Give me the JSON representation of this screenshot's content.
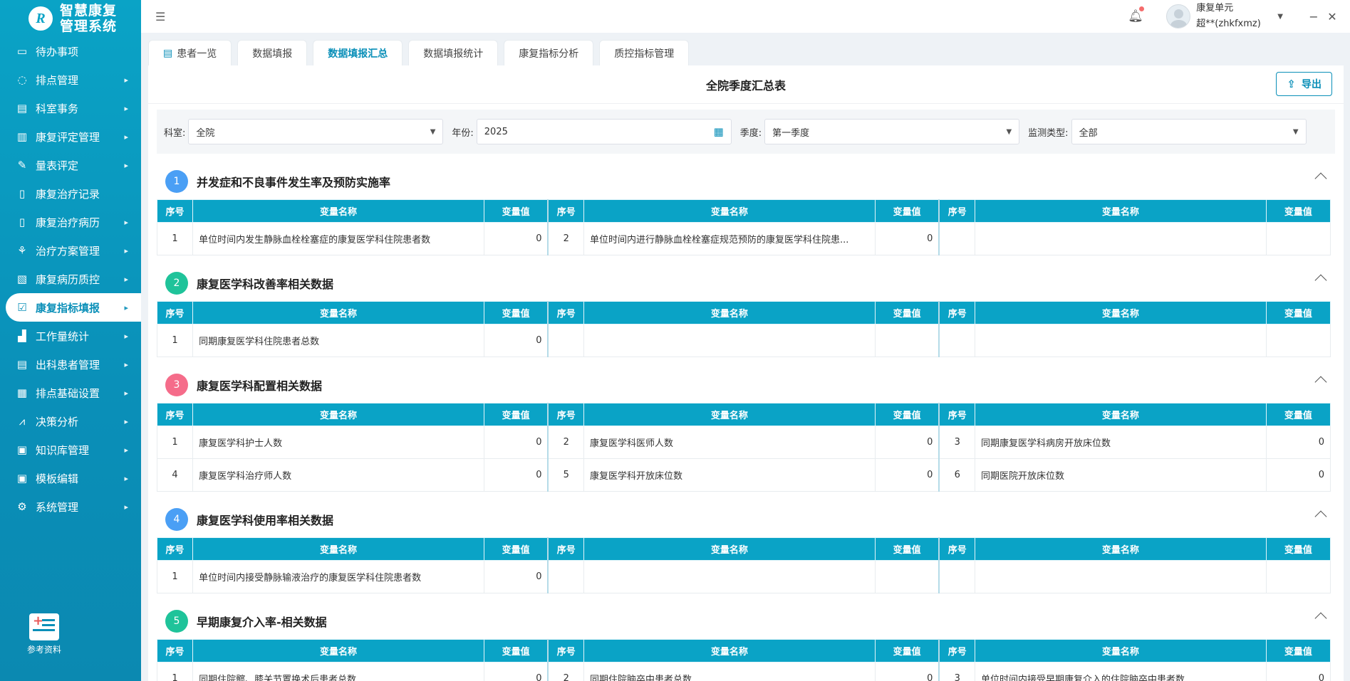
{
  "app": {
    "title_line1": "智慧康复",
    "title_line2": "管理系统",
    "logo_letter": "R"
  },
  "sidebar": {
    "items": [
      {
        "label": "待办事项",
        "icon": "message-icon",
        "arrow": false
      },
      {
        "label": "排点管理",
        "icon": "chat-icon",
        "arrow": true
      },
      {
        "label": "科室事务",
        "icon": "grid-icon",
        "arrow": true
      },
      {
        "label": "康复评定管理",
        "icon": "panel-icon",
        "arrow": true
      },
      {
        "label": "量表评定",
        "icon": "edit-icon",
        "arrow": true
      },
      {
        "label": "康复治疗记录",
        "icon": "document-icon",
        "arrow": false
      },
      {
        "label": "康复治疗病历",
        "icon": "file-icon",
        "arrow": true
      },
      {
        "label": "治疗方案管理",
        "icon": "plan-icon",
        "arrow": true
      },
      {
        "label": "康复病历质控",
        "icon": "quality-icon",
        "arrow": true
      },
      {
        "label": "康复指标填报",
        "icon": "report-icon",
        "arrow": true,
        "active": true
      },
      {
        "label": "工作量统计",
        "icon": "bar-chart-icon",
        "arrow": true
      },
      {
        "label": "出科患者管理",
        "icon": "patient-icon",
        "arrow": true
      },
      {
        "label": "排点基础设置",
        "icon": "settings-doc-icon",
        "arrow": true
      },
      {
        "label": "决策分析",
        "icon": "analysis-icon",
        "arrow": true
      },
      {
        "label": "知识库管理",
        "icon": "book-icon",
        "arrow": true
      },
      {
        "label": "模板编辑",
        "icon": "template-icon",
        "arrow": true
      },
      {
        "label": "系统管理",
        "icon": "gear-icon",
        "arrow": true
      }
    ],
    "reference_label": "参考资料"
  },
  "header": {
    "user_name": "康复单元",
    "user_account": "超**(zhkfxmz)"
  },
  "tabs": [
    {
      "label": "患者一览",
      "icon": true
    },
    {
      "label": "数据填报"
    },
    {
      "label": "数据填报汇总",
      "active": true
    },
    {
      "label": "数据填报统计"
    },
    {
      "label": "康复指标分析"
    },
    {
      "label": "质控指标管理"
    }
  ],
  "panel": {
    "title": "全院季度汇总表",
    "export_label": "导出"
  },
  "filters": {
    "dept_label": "科室:",
    "dept_value": "全院",
    "year_label": "年份:",
    "year_value": "2025",
    "quarter_label": "季度:",
    "quarter_value": "第一季度",
    "type_label": "监测类型:",
    "type_value": "全部"
  },
  "table_headers": {
    "seq": "序号",
    "name": "变量名称",
    "value": "变量值"
  },
  "sections": [
    {
      "num": "1",
      "color": "#4a9ff5",
      "title": "并发症和不良事件发生率及预防实施率",
      "rows": [
        [
          {
            "seq": "1",
            "name": "单位时间内发生静脉血栓栓塞症的康复医学科住院患者数",
            "value": "0"
          },
          {
            "seq": "2",
            "name": "单位时间内进行静脉血栓栓塞症规范预防的康复医学科住院患...",
            "value": "0"
          },
          {
            "seq": "",
            "name": "",
            "value": ""
          }
        ]
      ]
    },
    {
      "num": "2",
      "color": "#1fc39a",
      "title": "康复医学科改善率相关数据",
      "rows": [
        [
          {
            "seq": "1",
            "name": "同期康复医学科住院患者总数",
            "value": "0"
          },
          {
            "seq": "",
            "name": "",
            "value": ""
          },
          {
            "seq": "",
            "name": "",
            "value": ""
          }
        ]
      ]
    },
    {
      "num": "3",
      "color": "#f56c8a",
      "title": "康复医学科配置相关数据",
      "rows": [
        [
          {
            "seq": "1",
            "name": "康复医学科护士人数",
            "value": "0"
          },
          {
            "seq": "2",
            "name": "康复医学科医师人数",
            "value": "0"
          },
          {
            "seq": "3",
            "name": "同期康复医学科病房开放床位数",
            "value": "0"
          }
        ],
        [
          {
            "seq": "4",
            "name": "康复医学科治疗师人数",
            "value": "0"
          },
          {
            "seq": "5",
            "name": "康复医学科开放床位数",
            "value": "0"
          },
          {
            "seq": "6",
            "name": "同期医院开放床位数",
            "value": "0"
          }
        ]
      ]
    },
    {
      "num": "4",
      "color": "#4a9ff5",
      "title": "康复医学科使用率相关数据",
      "rows": [
        [
          {
            "seq": "1",
            "name": "单位时间内接受静脉输液治疗的康复医学科住院患者数",
            "value": "0"
          },
          {
            "seq": "",
            "name": "",
            "value": ""
          },
          {
            "seq": "",
            "name": "",
            "value": ""
          }
        ]
      ]
    },
    {
      "num": "5",
      "color": "#1fc39a",
      "title": "早期康复介入率-相关数据",
      "rows": [
        [
          {
            "seq": "1",
            "name": "同期住院髋、膝关节置换术后患者总数",
            "value": "0"
          },
          {
            "seq": "2",
            "name": "同期住院脑卒中患者总数",
            "value": "0"
          },
          {
            "seq": "3",
            "name": "单位时间内接受早期康复介入的住院脑卒中患者数",
            "value": "0"
          }
        ]
      ]
    }
  ]
}
